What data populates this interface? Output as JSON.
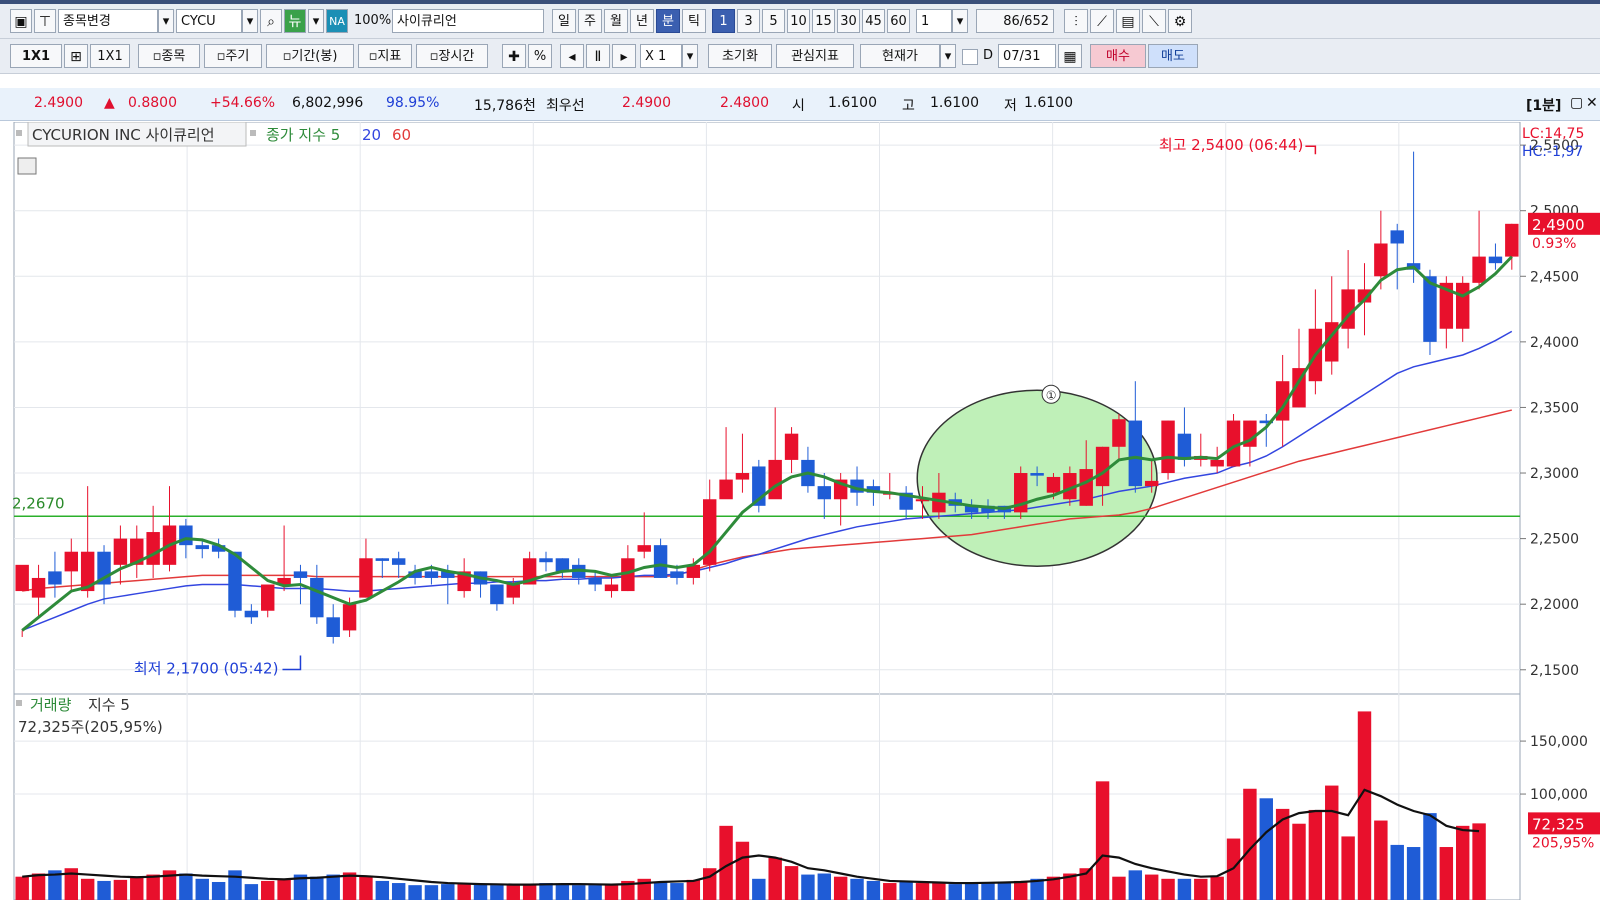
{
  "toolbar1": {
    "change_symbol": "종목변경",
    "symbol": "CYCU",
    "na_badge": "NA",
    "ratio": "100%",
    "company": "사이큐리언",
    "periods": [
      "일",
      "주",
      "월",
      "년",
      "분",
      "틱"
    ],
    "active_period": "분",
    "intervals": [
      "1",
      "3",
      "5",
      "10",
      "15",
      "30",
      "45",
      "60"
    ],
    "active_interval": "1",
    "interval_select": "1",
    "bar_count": "86",
    "bar_total": "/652"
  },
  "toolbar2": {
    "layout1": "1X1",
    "layout2": "1X1",
    "stock_btn": "▫종목",
    "period_btn": "▫주기",
    "range_btn": "▫기간(봉)",
    "indicator_btn": "▫지표",
    "session_btn": "▫장시간",
    "percent_btn": "%",
    "multiplier": "X 1",
    "reset_btn": "초기화",
    "watch_btn": "관심지표",
    "price_select": "현재가",
    "d_label": "D",
    "date": "07/31",
    "buy_btn": "매수",
    "sell_btn": "매도"
  },
  "quote": {
    "price": "2.4900",
    "change_arrow": "▲",
    "change": "0.8800",
    "change_pct": "+54.66%",
    "volume": "6,802,996",
    "vol_ratio": "98.95%",
    "amount": "15,786천",
    "best_label": "최우선",
    "best_ask": "2.4900",
    "best_bid": "2.4800",
    "open_label": "시",
    "open": "1.6100",
    "high_label": "고",
    "high": "1.6100",
    "low_label": "저",
    "low": "1.6100",
    "period_tag": "[1분]"
  },
  "chart_data": [
    {
      "type": "candlestick",
      "title": "CYCURION INC  사이큐리언",
      "legend": [
        {
          "name": "종가 지수 5",
          "color": "#2e8b3a"
        },
        {
          "name": "20",
          "color": "#3346e0"
        },
        {
          "name": "60",
          "color": "#e23a3a"
        }
      ],
      "ylim": [
        2.13,
        2.56
      ],
      "y_ticks": [
        "2,1500",
        "2,2000",
        "2,2500",
        "2,3000",
        "2,3500",
        "2,4000",
        "2,4500",
        "2,5000",
        "2,5500"
      ],
      "y_tick_values": [
        2.15,
        2.2,
        2.25,
        2.3,
        2.35,
        2.4,
        2.45,
        2.5,
        2.55
      ],
      "hline": {
        "value": 2.267,
        "label": "2,2670",
        "color": "#2bb02b"
      },
      "current_price": {
        "value": 2.49,
        "label": "2,4900",
        "pct": "0.93%"
      },
      "corner": {
        "lc": "LC:14,75",
        "hc": "HC:-1,97"
      },
      "high_annotation": {
        "label": "최고 2,5400 (06:44)",
        "value": 2.54,
        "index": 79
      },
      "low_annotation": {
        "label": "최저 2,1700 (05:42)",
        "value": 2.17,
        "index": 17
      },
      "highlight_circle": {
        "label": "①",
        "from_index": 57,
        "to_index": 67
      },
      "candles": [
        [
          2.21,
          2.23,
          2.18,
          2.175
        ],
        [
          2.205,
          2.22,
          2.23,
          2.19
        ],
        [
          2.225,
          2.215,
          2.24,
          2.205
        ],
        [
          2.225,
          2.24,
          2.25,
          2.21
        ],
        [
          2.21,
          2.24,
          2.29,
          2.205
        ],
        [
          2.24,
          2.215,
          2.245,
          2.2
        ],
        [
          2.23,
          2.25,
          2.26,
          2.215
        ],
        [
          2.23,
          2.25,
          2.26,
          2.22
        ],
        [
          2.23,
          2.255,
          2.275,
          2.22
        ],
        [
          2.23,
          2.26,
          2.29,
          2.225
        ],
        [
          2.26,
          2.245,
          2.265,
          2.235
        ],
        [
          2.245,
          2.242,
          2.25,
          2.235
        ],
        [
          2.245,
          2.24,
          2.25,
          2.235
        ],
        [
          2.24,
          2.195,
          2.24,
          2.19
        ],
        [
          2.195,
          2.19,
          2.2,
          2.185
        ],
        [
          2.195,
          2.215,
          2.215,
          2.19
        ],
        [
          2.215,
          2.22,
          2.26,
          2.21
        ],
        [
          2.225,
          2.22,
          2.23,
          2.2
        ],
        [
          2.22,
          2.19,
          2.23,
          2.185
        ],
        [
          2.19,
          2.175,
          2.2,
          2.17
        ],
        [
          2.18,
          2.2,
          2.205,
          2.175
        ],
        [
          2.205,
          2.235,
          2.25,
          2.205
        ],
        [
          2.235,
          2.233,
          2.235,
          2.22
        ],
        [
          2.235,
          2.23,
          2.24,
          2.22
        ],
        [
          2.225,
          2.22,
          2.23,
          2.215
        ],
        [
          2.225,
          2.22,
          2.23,
          2.215
        ],
        [
          2.225,
          2.22,
          2.23,
          2.2
        ],
        [
          2.21,
          2.225,
          2.235,
          2.205
        ],
        [
          2.225,
          2.215,
          2.225,
          2.205
        ],
        [
          2.215,
          2.2,
          2.215,
          2.195
        ],
        [
          2.205,
          2.215,
          2.22,
          2.2
        ],
        [
          2.215,
          2.235,
          2.24,
          2.215
        ],
        [
          2.235,
          2.232,
          2.24,
          2.225
        ],
        [
          2.235,
          2.225,
          2.235,
          2.22
        ],
        [
          2.23,
          2.22,
          2.235,
          2.215
        ],
        [
          2.22,
          2.215,
          2.225,
          2.21
        ],
        [
          2.21,
          2.215,
          2.22,
          2.205
        ],
        [
          2.21,
          2.235,
          2.245,
          2.21
        ],
        [
          2.24,
          2.245,
          2.27,
          2.235
        ],
        [
          2.245,
          2.22,
          2.25,
          2.22
        ],
        [
          2.225,
          2.22,
          2.23,
          2.215
        ],
        [
          2.22,
          2.23,
          2.235,
          2.215
        ],
        [
          2.23,
          2.28,
          2.295,
          2.225
        ],
        [
          2.28,
          2.295,
          2.335,
          2.285
        ],
        [
          2.295,
          2.3,
          2.33,
          2.285
        ],
        [
          2.305,
          2.275,
          2.31,
          2.27
        ],
        [
          2.28,
          2.31,
          2.35,
          2.285
        ],
        [
          2.31,
          2.33,
          2.335,
          2.3
        ],
        [
          2.31,
          2.29,
          2.32,
          2.285
        ],
        [
          2.29,
          2.28,
          2.3,
          2.265
        ],
        [
          2.28,
          2.295,
          2.3,
          2.26
        ],
        [
          2.295,
          2.285,
          2.305,
          2.275
        ],
        [
          2.29,
          2.285,
          2.295,
          2.275
        ],
        [
          2.285,
          2.285,
          2.3,
          2.28
        ],
        [
          2.285,
          2.272,
          2.29,
          2.265
        ],
        [
          2.28,
          2.28,
          2.29,
          2.265
        ],
        [
          2.27,
          2.285,
          2.3,
          2.265
        ],
        [
          2.28,
          2.275,
          2.285,
          2.27
        ],
        [
          2.275,
          2.27,
          2.28,
          2.265
        ],
        [
          2.275,
          2.27,
          2.28,
          2.265
        ],
        [
          2.275,
          2.27,
          2.275,
          2.265
        ],
        [
          2.27,
          2.3,
          2.305,
          2.265
        ],
        [
          2.3,
          2.298,
          2.305,
          2.29
        ],
        [
          2.285,
          2.297,
          2.3,
          2.28
        ],
        [
          2.28,
          2.3,
          2.305,
          2.275
        ],
        [
          2.275,
          2.303,
          2.325,
          2.275
        ],
        [
          2.29,
          2.32,
          2.32,
          2.275
        ],
        [
          2.32,
          2.341,
          2.345,
          2.31
        ],
        [
          2.34,
          2.29,
          2.37,
          2.285
        ],
        [
          2.29,
          2.294,
          2.31,
          2.285
        ],
        [
          2.3,
          2.34,
          2.34,
          2.295
        ],
        [
          2.33,
          2.31,
          2.35,
          2.305
        ],
        [
          2.31,
          2.313,
          2.33,
          2.305
        ],
        [
          2.305,
          2.31,
          2.32,
          2.3
        ],
        [
          2.305,
          2.34,
          2.345,
          2.305
        ],
        [
          2.32,
          2.34,
          2.34,
          2.305
        ],
        [
          2.34,
          2.338,
          2.345,
          2.32
        ],
        [
          2.34,
          2.37,
          2.39,
          2.32
        ],
        [
          2.35,
          2.38,
          2.41,
          2.35
        ],
        [
          2.37,
          2.41,
          2.44,
          2.36
        ],
        [
          2.385,
          2.415,
          2.45,
          2.375
        ],
        [
          2.41,
          2.44,
          2.47,
          2.395
        ],
        [
          2.43,
          2.44,
          2.46,
          2.405
        ],
        [
          2.45,
          2.475,
          2.5,
          2.44
        ],
        [
          2.485,
          2.475,
          2.49,
          2.44
        ],
        [
          2.46,
          2.455,
          2.545,
          2.445
        ],
        [
          2.45,
          2.4,
          2.455,
          2.39
        ],
        [
          2.41,
          2.445,
          2.45,
          2.395
        ],
        [
          2.41,
          2.445,
          2.45,
          2.4
        ],
        [
          2.445,
          2.465,
          2.5,
          2.44
        ],
        [
          2.465,
          2.46,
          2.475,
          2.455
        ],
        [
          2.465,
          2.49,
          2.49,
          2.455
        ]
      ],
      "ma5": [
        2.18,
        2.19,
        2.2,
        2.21,
        2.213,
        2.22,
        2.227,
        2.232,
        2.238,
        2.245,
        2.25,
        2.249,
        2.245,
        2.238,
        2.228,
        2.218,
        2.214,
        2.215,
        2.21,
        2.205,
        2.2,
        2.203,
        2.21,
        2.217,
        2.225,
        2.228,
        2.225,
        2.223,
        2.22,
        2.218,
        2.215,
        2.218,
        2.222,
        2.225,
        2.226,
        2.225,
        2.222,
        2.224,
        2.228,
        2.23,
        2.228,
        2.23,
        2.24,
        2.255,
        2.27,
        2.28,
        2.29,
        2.297,
        2.3,
        2.297,
        2.292,
        2.288,
        2.286,
        2.285,
        2.283,
        2.281,
        2.279,
        2.277,
        2.275,
        2.274,
        2.273,
        2.276,
        2.28,
        2.283,
        2.288,
        2.293,
        2.3,
        2.31,
        2.312,
        2.31,
        2.312,
        2.311,
        2.312,
        2.311,
        2.32,
        2.325,
        2.335,
        2.35,
        2.37,
        2.39,
        2.405,
        2.42,
        2.432,
        2.447,
        2.455,
        2.457,
        2.445,
        2.44,
        2.435,
        2.442,
        2.452,
        2.465
      ],
      "ma20": [
        2.18,
        2.185,
        2.19,
        2.195,
        2.2,
        2.204,
        2.206,
        2.208,
        2.21,
        2.212,
        2.214,
        2.215,
        2.215,
        2.215,
        2.214,
        2.213,
        2.212,
        2.212,
        2.212,
        2.211,
        2.21,
        2.21,
        2.211,
        2.212,
        2.213,
        2.214,
        2.215,
        2.216,
        2.216,
        2.217,
        2.217,
        2.218,
        2.218,
        2.219,
        2.219,
        2.22,
        2.22,
        2.221,
        2.222,
        2.222,
        2.223,
        2.225,
        2.228,
        2.231,
        2.235,
        2.238,
        2.242,
        2.246,
        2.25,
        2.253,
        2.256,
        2.259,
        2.261,
        2.263,
        2.265,
        2.266,
        2.267,
        2.268,
        2.269,
        2.27,
        2.271,
        2.272,
        2.274,
        2.276,
        2.278,
        2.28,
        2.283,
        2.286,
        2.288,
        2.29,
        2.293,
        2.296,
        2.298,
        2.3,
        2.305,
        2.308,
        2.313,
        2.32,
        2.328,
        2.336,
        2.344,
        2.352,
        2.36,
        2.368,
        2.376,
        2.381,
        2.384,
        2.387,
        2.39,
        2.395,
        2.401,
        2.408
      ],
      "ma60": [
        2.21,
        2.212,
        2.213,
        2.214,
        2.215,
        2.216,
        2.217,
        2.218,
        2.219,
        2.22,
        2.221,
        2.222,
        2.222,
        2.222,
        2.222,
        2.222,
        2.222,
        2.222,
        2.221,
        2.221,
        2.221,
        2.221,
        2.221,
        2.221,
        2.221,
        2.221,
        2.221,
        2.221,
        2.221,
        2.221,
        2.221,
        2.221,
        2.221,
        2.221,
        2.221,
        2.221,
        2.221,
        2.221,
        2.221,
        2.221,
        2.222,
        2.226,
        2.23,
        2.233,
        2.236,
        2.238,
        2.24,
        2.242,
        2.243,
        2.244,
        2.245,
        2.246,
        2.247,
        2.248,
        2.249,
        2.25,
        2.251,
        2.252,
        2.253,
        2.255,
        2.257,
        2.259,
        2.261,
        2.263,
        2.265,
        2.266,
        2.267,
        2.268,
        2.27,
        2.273,
        2.277,
        2.281,
        2.285,
        2.289,
        2.293,
        2.297,
        2.301,
        2.305,
        2.309,
        2.312,
        2.315,
        2.318,
        2.321,
        2.324,
        2.327,
        2.33,
        2.333,
        2.336,
        2.339,
        2.342,
        2.345,
        2.348
      ]
    },
    {
      "type": "bar",
      "title": "거래량",
      "legend_extra": "지수 5",
      "value_label": "72,325주(205,95%)",
      "ylim": [
        0,
        185000
      ],
      "y_ticks": [
        "100,000",
        "150,000"
      ],
      "y_tick_values": [
        100000,
        150000
      ],
      "current": {
        "value": 72325,
        "label": "72,325",
        "pct": "205,95%"
      },
      "volumes": [
        22000,
        25000,
        28000,
        30000,
        20000,
        18000,
        19000,
        21000,
        24000,
        28000,
        25000,
        20000,
        17000,
        28000,
        15000,
        18000,
        20000,
        24000,
        22000,
        24000,
        26000,
        22000,
        18000,
        16000,
        14000,
        14000,
        15000,
        16000,
        15000,
        14000,
        14000,
        14000,
        16000,
        15000,
        14000,
        14000,
        14000,
        18000,
        20000,
        17000,
        16000,
        19000,
        30000,
        70000,
        55000,
        20000,
        40000,
        32000,
        24000,
        25000,
        22000,
        20000,
        18000,
        16000,
        17000,
        16000,
        16000,
        15000,
        16000,
        17000,
        16000,
        18000,
        20000,
        22000,
        25000,
        30000,
        112000,
        22000,
        28000,
        24000,
        20000,
        20000,
        20000,
        22000,
        58000,
        105000,
        96000,
        86000,
        72000,
        85000,
        108000,
        60000,
        178000,
        75000,
        52000,
        50000,
        82000,
        50000,
        70000,
        72325
      ],
      "ma5": [
        22000,
        23500,
        24000,
        25000,
        24000,
        23000,
        22000,
        21500,
        22000,
        23000,
        24000,
        23000,
        22500,
        22000,
        21000,
        20000,
        19500,
        20500,
        21000,
        22000,
        23000,
        22500,
        21500,
        20000,
        18500,
        17000,
        16000,
        15500,
        15000,
        14800,
        14500,
        14500,
        14800,
        15000,
        15000,
        14800,
        14500,
        15000,
        16000,
        17000,
        17500,
        18000,
        22000,
        32000,
        40000,
        42000,
        40000,
        36000,
        30000,
        28000,
        25000,
        22000,
        20000,
        18000,
        17500,
        17000,
        16500,
        16000,
        16000,
        16200,
        16500,
        17000,
        18000,
        19500,
        22000,
        25000,
        42000,
        40000,
        34000,
        30000,
        27000,
        24000,
        22000,
        22500,
        30000,
        48000,
        64000,
        76000,
        82000,
        84000,
        84000,
        80000,
        104000,
        98000,
        90000,
        84000,
        80000,
        70000,
        66000,
        65000
      ]
    }
  ]
}
